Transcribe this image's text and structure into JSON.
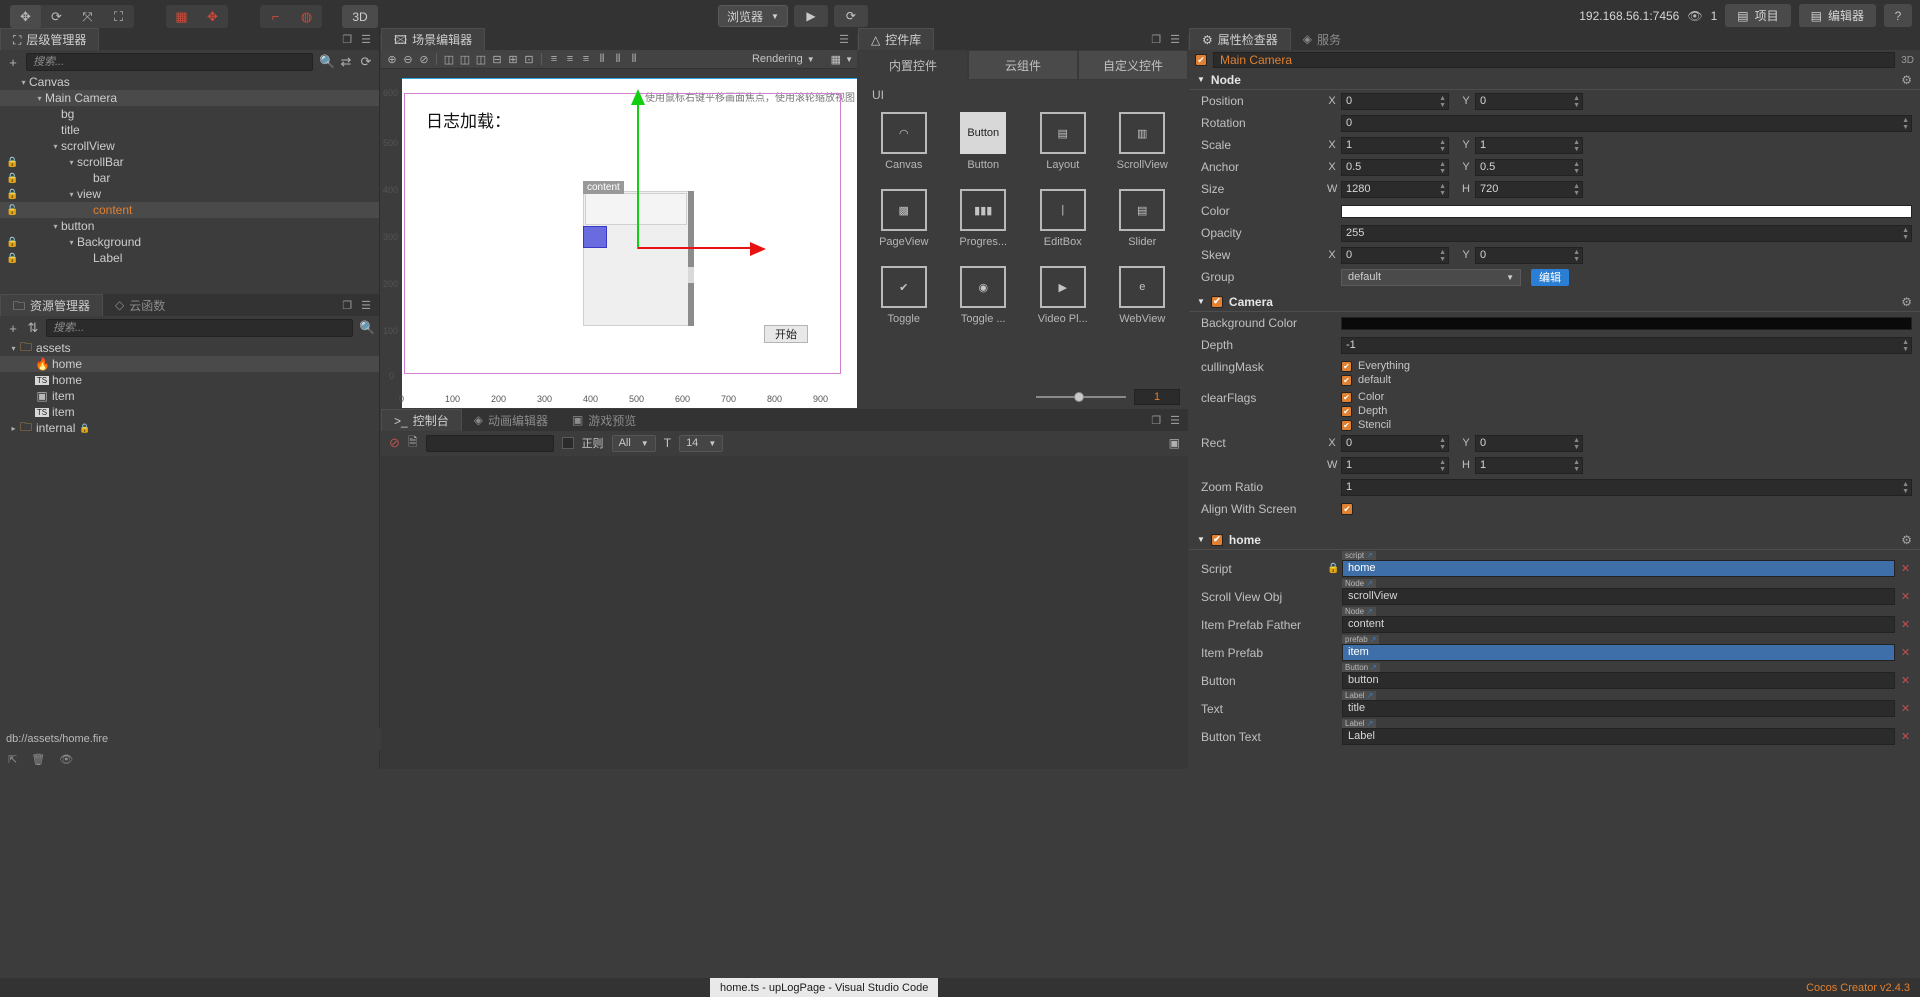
{
  "topbar": {
    "tools": [
      {
        "name": "move-tool",
        "glyph": "✥"
      },
      {
        "name": "rotate-tool",
        "glyph": "⟳"
      },
      {
        "name": "scale-tool",
        "glyph": "⤧"
      },
      {
        "name": "rect-tool",
        "glyph": "⛶"
      }
    ],
    "snap_tools": [
      {
        "name": "align-grid-tool",
        "glyph": "▦"
      },
      {
        "name": "add-node-tool",
        "glyph": "✥"
      }
    ],
    "pivot_tools": [
      {
        "name": "pivot-tool",
        "glyph": "⌐"
      },
      {
        "name": "global-local-tool",
        "glyph": "◍"
      }
    ],
    "mode_3d": "3D",
    "browser_select": "浏览器",
    "play_label": "▶",
    "reload_label": "⟳",
    "ip_address": "192.168.56.1:7456",
    "device_count": "1",
    "project_label": "项目",
    "editor_label": "编辑器",
    "help_label": "?"
  },
  "hierarchy": {
    "tab_label": "层级管理器",
    "search_placeholder": "搜索...",
    "add_label": "+",
    "nodes": [
      {
        "label": "Canvas",
        "depth": 0,
        "arrow": "▾",
        "locked": false,
        "selected": false,
        "color": "white"
      },
      {
        "label": "Main Camera",
        "depth": 1,
        "arrow": "▾",
        "locked": false,
        "selected": true,
        "color": "white"
      },
      {
        "label": "bg",
        "depth": 2,
        "arrow": "",
        "locked": false,
        "selected": false,
        "color": "white"
      },
      {
        "label": "title",
        "depth": 2,
        "arrow": "",
        "locked": false,
        "selected": false,
        "color": "white"
      },
      {
        "label": "scrollView",
        "depth": 2,
        "arrow": "▾",
        "locked": false,
        "selected": false,
        "color": "white"
      },
      {
        "label": "scrollBar",
        "depth": 3,
        "arrow": "▾",
        "locked": true,
        "selected": false,
        "color": "white"
      },
      {
        "label": "bar",
        "depth": 4,
        "arrow": "",
        "locked": true,
        "selected": false,
        "color": "white"
      },
      {
        "label": "view",
        "depth": 3,
        "arrow": "▾",
        "locked": true,
        "selected": false,
        "color": "white"
      },
      {
        "label": "content",
        "depth": 4,
        "arrow": "",
        "locked": false,
        "unlocked": true,
        "selected": true,
        "color": "orange"
      },
      {
        "label": "button",
        "depth": 2,
        "arrow": "▾",
        "locked": false,
        "selected": false,
        "color": "white"
      },
      {
        "label": "Background",
        "depth": 3,
        "arrow": "▾",
        "locked": true,
        "selected": false,
        "color": "white"
      },
      {
        "label": "Label",
        "depth": 4,
        "arrow": "",
        "locked": true,
        "selected": false,
        "color": "white"
      }
    ]
  },
  "assets": {
    "tabs": [
      {
        "label": "资源管理器",
        "selected": true,
        "icon": "folder-icon"
      },
      {
        "label": "云函数",
        "selected": false,
        "icon": "cloud-icon"
      }
    ],
    "search_placeholder": "搜索...",
    "add_label": "+",
    "sort_label": "⇅",
    "items": [
      {
        "label": "assets",
        "depth": 0,
        "arrow": "▾",
        "icon": "folder",
        "selected": false
      },
      {
        "label": "home",
        "depth": 1,
        "arrow": "",
        "icon": "fire",
        "selected": true
      },
      {
        "label": "home",
        "depth": 1,
        "arrow": "",
        "icon": "ts",
        "selected": false
      },
      {
        "label": "item",
        "depth": 1,
        "arrow": "",
        "icon": "prefab",
        "selected": false
      },
      {
        "label": "item",
        "depth": 1,
        "arrow": "",
        "icon": "ts",
        "selected": false
      },
      {
        "label": "internal",
        "depth": 0,
        "arrow": "▸",
        "icon": "folder",
        "selected": false,
        "locked": true
      }
    ],
    "db_path": "db://assets/home.fire"
  },
  "scene": {
    "tab_label": "场景编辑器",
    "zoom_tools": [
      "zoom-in-icon",
      "zoom-out-icon",
      "zoom-reset-icon"
    ],
    "align_tools": [
      "align-left",
      "align-center-h",
      "align-right",
      "align-top",
      "align-middle",
      "align-bottom",
      "dist-v-top",
      "dist-v-center",
      "dist-v-bottom",
      "dist-h-left",
      "dist-h-center",
      "dist-h-right"
    ],
    "rendering_label": "Rendering",
    "camera_label": "▦",
    "hint_text": "使用鼠标右键平移画面焦点，使用滚轮缩放视图",
    "ruler_y": [
      "600",
      "500",
      "400",
      "300",
      "200",
      "100",
      "0"
    ],
    "ruler_x": [
      "0",
      "100",
      "200",
      "300",
      "400",
      "500",
      "600",
      "700",
      "800",
      "900"
    ],
    "game_title": "日志加载：",
    "content_label": "content",
    "start_button": "开始"
  },
  "console": {
    "tabs": [
      {
        "label": "控制台",
        "selected": true,
        "icon": "terminal-icon"
      },
      {
        "label": "动画编辑器",
        "selected": false,
        "icon": "anim-icon"
      },
      {
        "label": "游戏预览",
        "selected": false,
        "icon": "preview-icon"
      }
    ],
    "clear_label": "⊘",
    "copy_label": "🗎",
    "filter_placeholder": "",
    "regex_label": "正则",
    "level_select": "All",
    "font_icon": "T",
    "font_size": "14",
    "expand_label": "▣"
  },
  "widgets": {
    "tab_label": "控件库",
    "tabs": [
      {
        "label": "内置控件",
        "selected": true
      },
      {
        "label": "云组件",
        "selected": false
      },
      {
        "label": "自定义控件",
        "selected": false
      }
    ],
    "section": "UI",
    "items": [
      {
        "label": "Canvas",
        "icon": "canvas-icon"
      },
      {
        "label": "Button",
        "icon": "button-icon"
      },
      {
        "label": "Layout",
        "icon": "layout-icon"
      },
      {
        "label": "ScrollView",
        "icon": "scrollview-icon"
      },
      {
        "label": "PageView",
        "icon": "pageview-icon"
      },
      {
        "label": "Progres...",
        "icon": "progressbar-icon"
      },
      {
        "label": "EditBox",
        "icon": "editbox-icon"
      },
      {
        "label": "Slider",
        "icon": "slider-icon"
      },
      {
        "label": "Toggle",
        "icon": "toggle-icon"
      },
      {
        "label": "Toggle ...",
        "icon": "togglegroup-icon"
      },
      {
        "label": "Video Pl...",
        "icon": "videoplayer-icon"
      },
      {
        "label": "WebView",
        "icon": "webview-icon"
      }
    ],
    "zoom_value": "1"
  },
  "inspector": {
    "tabs": [
      {
        "label": "属性检查器",
        "selected": true,
        "icon": "gear-icon"
      },
      {
        "label": "服务",
        "selected": false,
        "icon": "service-icon"
      }
    ],
    "node_name": "Main Camera",
    "node_enabled": true,
    "badge_3d": "3D",
    "sections": {
      "node": {
        "title": "Node",
        "position": {
          "label": "Position",
          "x": "0",
          "y": "0"
        },
        "rotation": {
          "label": "Rotation",
          "value": "0"
        },
        "scale": {
          "label": "Scale",
          "x": "1",
          "y": "1"
        },
        "anchor": {
          "label": "Anchor",
          "x": "0.5",
          "y": "0.5"
        },
        "size": {
          "label": "Size",
          "w": "1280",
          "h": "720"
        },
        "color": {
          "label": "Color",
          "value": "#ffffff"
        },
        "opacity": {
          "label": "Opacity",
          "value": "255"
        },
        "skew": {
          "label": "Skew",
          "x": "0",
          "y": "0"
        },
        "group": {
          "label": "Group",
          "value": "default",
          "edit_button": "编辑"
        }
      },
      "camera": {
        "title": "Camera",
        "enabled": true,
        "background_color": {
          "label": "Background Color",
          "value": "#000000"
        },
        "depth": {
          "label": "Depth",
          "value": "-1"
        },
        "culling_mask": {
          "label": "cullingMask",
          "options": [
            {
              "label": "Everything",
              "checked": true
            },
            {
              "label": "default",
              "checked": true
            }
          ]
        },
        "clear_flags": {
          "label": "clearFlags",
          "options": [
            {
              "label": "Color",
              "checked": true
            },
            {
              "label": "Depth",
              "checked": true
            },
            {
              "label": "Stencil",
              "checked": true
            }
          ]
        },
        "rect": {
          "label": "Rect",
          "x": "0",
          "y": "0",
          "w": "1",
          "h": "1"
        },
        "zoom_ratio": {
          "label": "Zoom Ratio",
          "value": "1"
        },
        "align_with_screen": {
          "label": "Align With Screen",
          "checked": true
        }
      },
      "home": {
        "title": "home",
        "enabled": true,
        "props": [
          {
            "label": "Script",
            "tag": "script",
            "value": "home",
            "highlight": true,
            "locked": true
          },
          {
            "label": "Scroll View Obj",
            "tag": "Node",
            "value": "scrollView",
            "highlight": false
          },
          {
            "label": "Item Prefab Father",
            "tag": "Node",
            "value": "content",
            "highlight": false
          },
          {
            "label": "Item Prefab",
            "tag": "prefab",
            "value": "item",
            "highlight": true
          },
          {
            "label": "Button",
            "tag": "Button",
            "value": "button",
            "highlight": false
          },
          {
            "label": "Text",
            "tag": "Label",
            "value": "title",
            "highlight": false
          },
          {
            "label": "Button Text",
            "tag": "Label",
            "value": "Label",
            "highlight": false
          }
        ]
      }
    }
  },
  "statusbar": {
    "vscode_title": "home.ts - upLogPage - Visual Studio Code",
    "version": "Cocos Creator v2.4.3"
  },
  "colors": {
    "accent": "#e08030",
    "panel_bg": "#3c3c3c",
    "dark_bg": "#333333",
    "field_bg": "#2b2b2b",
    "blue": "#2a7fd4"
  }
}
